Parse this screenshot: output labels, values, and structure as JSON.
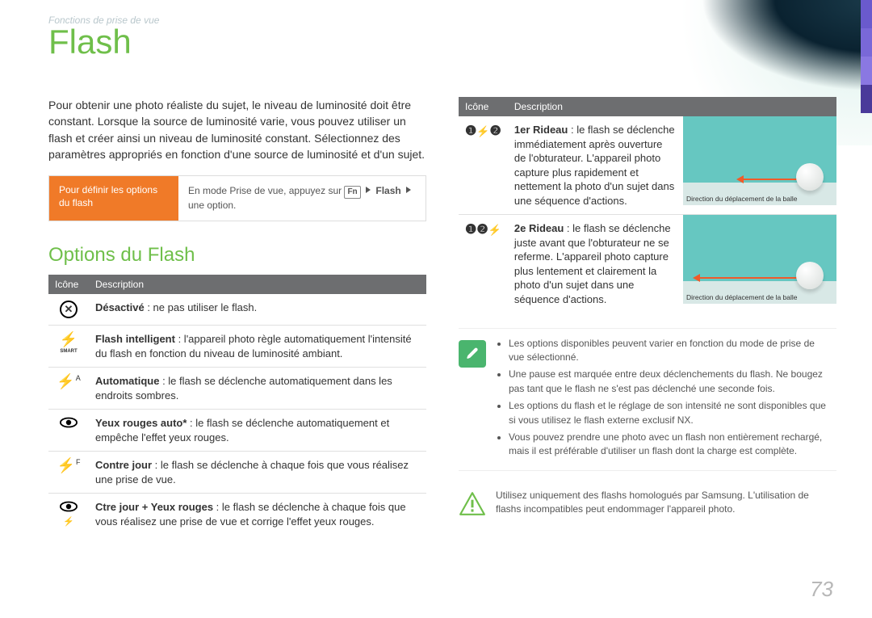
{
  "breadcrumb": "Fonctions de prise de vue",
  "title": "Flash",
  "intro": "Pour obtenir une photo réaliste du sujet, le niveau de luminosité doit être constant. Lorsque la source de luminosité varie, vous pouvez utiliser un flash et créer ainsi un niveau de luminosité constant. Sélectionnez des paramètres appropriés en fonction d'une source de luminosité et d'un sujet.",
  "define": {
    "label": "Pour définir les options du flash",
    "body_prefix": "En mode Prise de vue, appuyez sur ",
    "fn_key": "Fn",
    "flash_word": "Flash",
    "body_suffix": "une option."
  },
  "subheading": "Options du Flash",
  "table_headers": {
    "icon": "Icône",
    "desc": "Description"
  },
  "options_left": [
    {
      "icon_name": "flash-off-icon",
      "title": "Désactivé",
      "rest": " : ne pas utiliser le flash."
    },
    {
      "icon_name": "flash-smart-icon",
      "title": "Flash intelligent",
      "rest": " : l'appareil photo règle automatiquement l'intensité du flash en fonction du niveau de luminosité ambiant."
    },
    {
      "icon_name": "flash-auto-icon",
      "title": "Automatique",
      "rest": " : le flash se déclenche automatiquement dans les endroits sombres."
    },
    {
      "icon_name": "flash-redeye-auto-icon",
      "title": "Yeux rouges auto*",
      "rest": " : le flash se déclenche automatiquement et empêche l'effet yeux rouges."
    },
    {
      "icon_name": "flash-fill-icon",
      "title": "Contre jour",
      "rest": " : le flash se déclenche à chaque fois que vous réalisez une prise de vue."
    },
    {
      "icon_name": "flash-fill-redeye-icon",
      "title": "Ctre jour + Yeux rouges",
      "rest": " : le flash se déclenche à chaque fois que vous réalisez une prise de vue et corrige l'effet yeux rouges."
    }
  ],
  "options_right": [
    {
      "icon_name": "first-curtain-icon",
      "title": "1er Rideau",
      "rest": " : le flash se déclenche immédiatement après ouverture de l'obturateur. L'appareil photo capture plus rapidement et nettement la photo d'un sujet dans une séquence d'actions.",
      "caption": "Direction du déplacement de la balle"
    },
    {
      "icon_name": "second-curtain-icon",
      "title": "2e Rideau",
      "rest": " : le flash se déclenche juste avant que l'obturateur ne se referme. L'appareil photo capture plus lentement et clairement la photo d'un sujet dans une séquence d'actions.",
      "caption": "Direction du déplacement de la balle"
    }
  ],
  "notes": [
    "Les options disponibles peuvent varier en fonction du mode de prise de vue sélectionné.",
    "Une pause est marquée entre deux déclenchements du flash. Ne bougez pas tant que le flash ne s'est pas déclenché une seconde fois.",
    "Les options du flash et le réglage de son intensité ne sont disponibles que si vous utilisez le flash externe exclusif NX.",
    "Vous pouvez prendre une photo avec un flash non entièrement rechargé, mais il est préférable d'utiliser un flash dont la charge est complète."
  ],
  "warning": "Utilisez uniquement des flashs homologués par Samsung. L'utilisation de flashs incompatibles peut endommager l'appareil photo.",
  "page_number": "73",
  "smart_label": "SMART"
}
